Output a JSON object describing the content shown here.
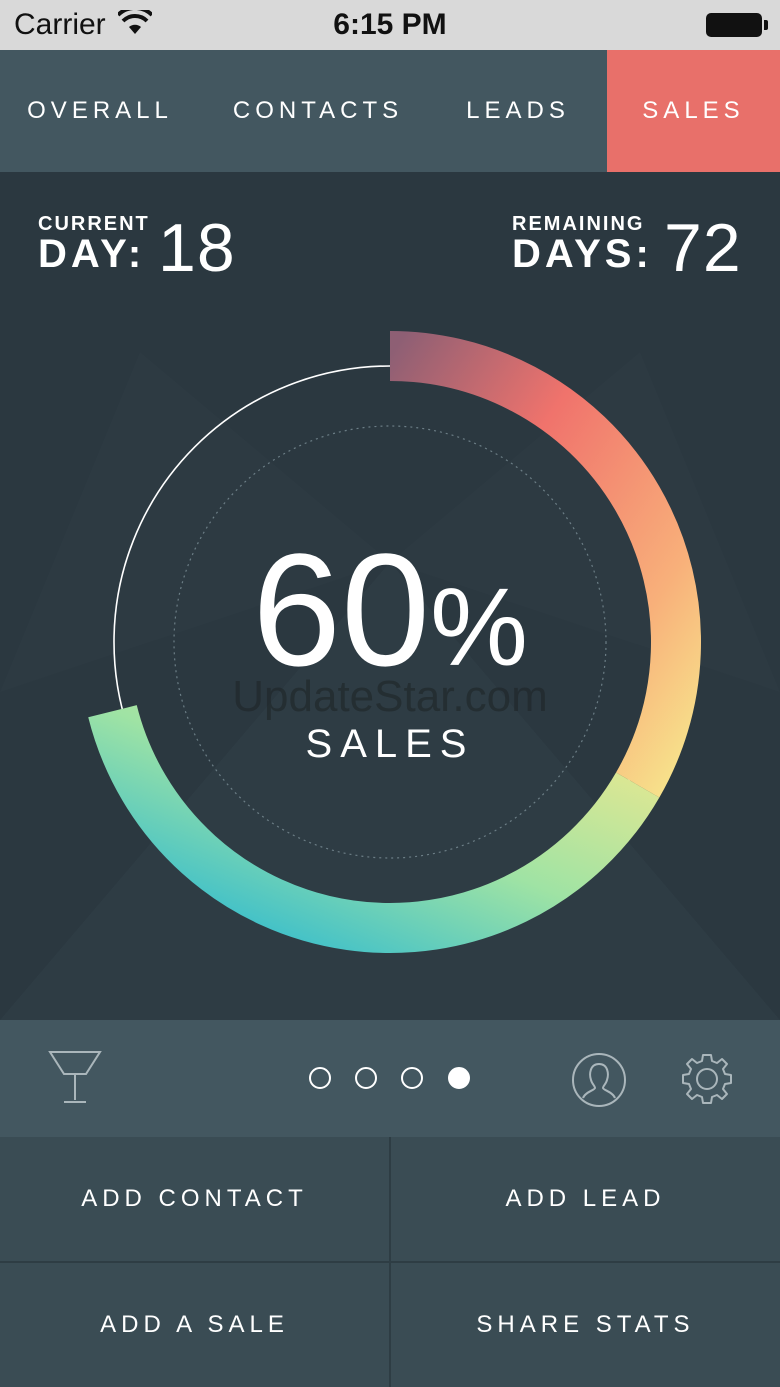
{
  "status_bar": {
    "carrier": "Carrier",
    "time": "6:15 PM",
    "wifi_icon": "wifi-icon",
    "battery_icon": "battery-icon"
  },
  "tabs": [
    {
      "label": "OVERALL",
      "active": false
    },
    {
      "label": "CONTACTS",
      "active": false
    },
    {
      "label": "LEADS",
      "active": false
    },
    {
      "label": "SALES",
      "active": true
    }
  ],
  "colors": {
    "accent": "#e8706a",
    "background": "#2b3840",
    "panel": "#435760",
    "gradient_start": "#9a6277",
    "gradient_mid": "#f9e38a",
    "gradient_end": "#20b5d4"
  },
  "stats": {
    "current": {
      "small": "CURRENT",
      "big": "DAY:",
      "value": "18"
    },
    "remaining": {
      "small": "REMAINING",
      "big": "DAYS:",
      "value": "72"
    }
  },
  "progress": {
    "value": "60",
    "unit": "%",
    "label": "SALES",
    "fraction": 0.6
  },
  "watermark": "UpdateStar.com",
  "toolbar": {
    "trophy_icon": "trophy-icon",
    "profile_icon": "profile-icon",
    "settings_icon": "gear-icon",
    "page_count": 4,
    "active_page": 4
  },
  "actions": {
    "add_contact": "ADD CONTACT",
    "add_lead": "ADD LEAD",
    "add_sale": "ADD A SALE",
    "share_stats": "SHARE STATS"
  }
}
